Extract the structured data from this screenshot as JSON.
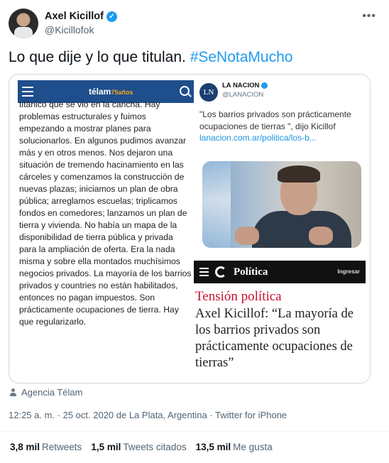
{
  "author": {
    "name": "Axel Kicillof",
    "handle": "@Kicillofok"
  },
  "menu": {
    "glyph": "•••"
  },
  "tweet": {
    "text_plain": "Lo que dije y lo que titulan. ",
    "hashtag": "#SeNotaMucho"
  },
  "media": {
    "telam": {
      "logo": "télam",
      "logo_years": "75años",
      "body": "titánico que se vio en la cancha. Hay problemas estructurales y fuimos empezando a mostrar planes para solucionarlos. En algunos pudimos avanzar más y en otros menos. Nos dejaron una situación de tremendo hacinamiento en las cárceles y comenzamos la construcción de nuevas plazas; iniciamos un plan de obra pública; arreglamos escuelas; triplicamos fondos en comedores; lanzamos un plan de tierra y vivienda. No había un mapa de la disponibilidad de tierra pública y privada para la ampliación de oferta. Era la nada misma y sobre ella montados muchísimos negocios privados. La mayoría de los barrios privados y countries no están habilitados, entonces no pagan impuestos. Son prácticamente ocupaciones de tierra. Hay que regularizarlo."
    },
    "nacion": {
      "logo": "LN",
      "name": "LA NACION",
      "handle": "@LANACION",
      "quote": "\"Los barrios privados son prácticamente ocupaciones de tierras \", dijo Kicillof ",
      "link": "lanacion.com.ar/politica/los-b..."
    },
    "politica": {
      "section": "Política",
      "login": "Ingresar",
      "kicker": "Tensión política",
      "headline": "Axel Kicillof: “La mayoría de los barrios privados son prácticamente ocupaciones de tierras”"
    }
  },
  "source": {
    "label": "Agencia Télam"
  },
  "meta": {
    "line": "12:25 a. m. · 25 oct. 2020 de La Plata, Argentina · Twitter for iPhone"
  },
  "stats": [
    {
      "value": "3,8 mil",
      "label": "Retweets"
    },
    {
      "value": "1,5 mil",
      "label": "Tweets citados"
    },
    {
      "value": "13,5 mil",
      "label": "Me gusta"
    }
  ],
  "colors": {
    "link": "#1d9bf0",
    "telam_bar": "#1f4e8c",
    "kicker": "#c8102e"
  }
}
